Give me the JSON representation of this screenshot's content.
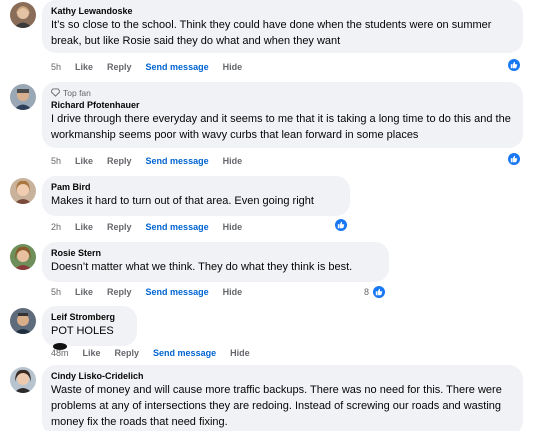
{
  "action_labels": {
    "like": "Like",
    "reply": "Reply",
    "send_message": "Send message",
    "hide": "Hide"
  },
  "colors": {
    "bubble": "#f0f2f5",
    "link": "#0064d1",
    "meta": "#65676b",
    "reaction": "#1877f2"
  },
  "comments": [
    {
      "author": "Kathy Lewandoske",
      "text": "It’s so close to the school. Think they could have done when the students were on summer break, but like Rosie said they do what and when they want",
      "time": "5h",
      "reaction_icon": "like-icon"
    },
    {
      "badge": "Top fan",
      "badge_icon": "diamond-icon",
      "author": "Richard Pfotenhauer",
      "text": "I drive through there everyday and it seems to me that it is taking a long time to do this and the workmanship seems poor with wavy curbs that lean forward in some places",
      "time": "5h",
      "reaction_icon": "like-icon"
    },
    {
      "author": "Pam Bird",
      "text": "Makes it hard to turn out of that area. Even going right",
      "time": "2h",
      "reaction_icon": "like-icon"
    },
    {
      "author": "Rosie Stern",
      "text": "Doesn’t matter what we think. They do what they think is best.",
      "time": "5h",
      "reaction_count": "8",
      "reaction_icon": "like-icon"
    },
    {
      "author": "Leif Stromberg",
      "text": "POT HOLES",
      "emoji": "hole-emoji",
      "time": "48m"
    },
    {
      "author": "Cindy Lisko-Cridelich",
      "text": "Waste of money and will cause more traffic backups. There was no need for this. There were problems at any of intersections they are redoing. Instead of screwing our roads and wasting money fix the roads that need fixing."
    }
  ]
}
